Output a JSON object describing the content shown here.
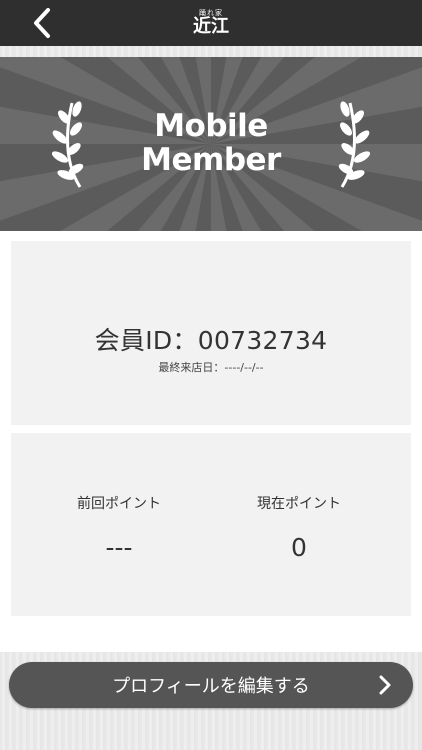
{
  "header": {
    "logo_sub": "踊れ家",
    "logo_main": "近江"
  },
  "banner": {
    "line1": "Mobile",
    "line2": "Member"
  },
  "member": {
    "id_text": "会員ID：00732734",
    "last_visit": "最終来店日：----/--/--"
  },
  "points": {
    "previous_label": "前回ポイント",
    "previous_value": "---",
    "current_label": "現在ポイント",
    "current_value": "0"
  },
  "footer": {
    "edit_label": "プロフィールを編集する"
  },
  "icons": {
    "back": "chevron-left-icon",
    "laurel_left": "laurel-left-icon",
    "laurel_right": "laurel-right-icon",
    "forward": "chevron-right-icon"
  },
  "colors": {
    "navbar": "#2f2f2f",
    "banner": "#5a5a5a",
    "button": "#555555",
    "card": "#f2f2f2"
  }
}
